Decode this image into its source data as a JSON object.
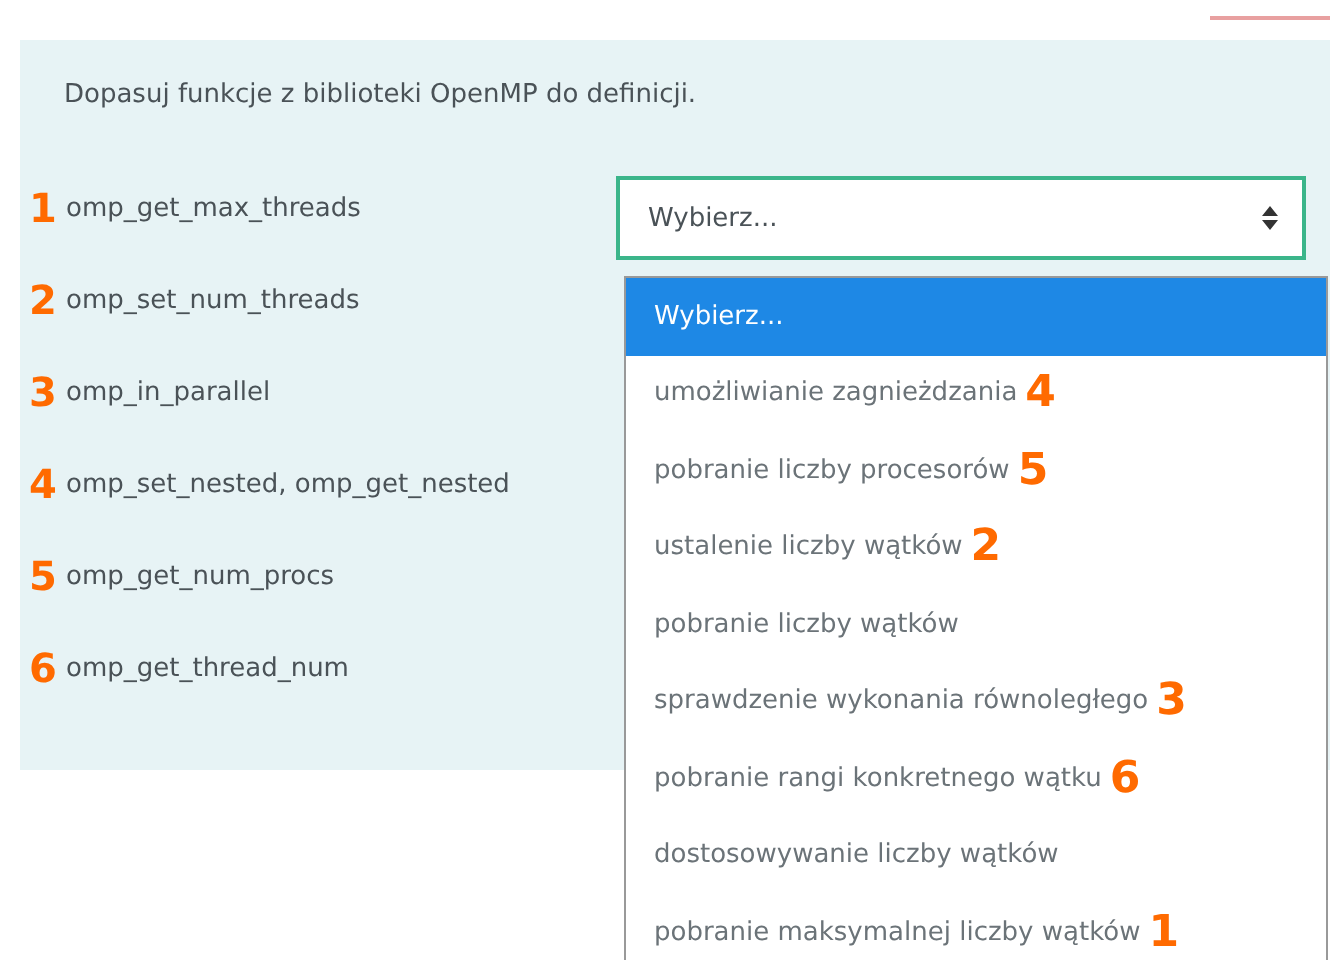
{
  "question": "Dopasuj funkcje z biblioteki OpenMP do definicji.",
  "rows": [
    {
      "mark": "1",
      "label": "omp_get_max_threads"
    },
    {
      "mark": "2",
      "label": "omp_set_num_threads"
    },
    {
      "mark": "3",
      "label": "omp_in_parallel"
    },
    {
      "mark": "4",
      "label": "omp_set_nested, omp_get_nested"
    },
    {
      "mark": "5",
      "label": "omp_get_num_procs"
    },
    {
      "mark": "6",
      "label": "omp_get_thread_num"
    }
  ],
  "select": {
    "value": "Wybierz..."
  },
  "options": [
    {
      "label": "Wybierz...",
      "selected": true
    },
    {
      "label": "umożliwianie zagnieżdzania",
      "selected": false,
      "mark": "4"
    },
    {
      "label": "pobranie liczby procesorów",
      "selected": false,
      "mark": "5"
    },
    {
      "label": "ustalenie liczby wątków",
      "selected": false,
      "mark": "2"
    },
    {
      "label": "pobranie liczby wątków",
      "selected": false
    },
    {
      "label": "sprawdzenie wykonania równoległego",
      "selected": false,
      "mark": "3"
    },
    {
      "label": "pobranie rangi konkretnego wątku",
      "selected": false,
      "mark": "6"
    },
    {
      "label": "dostosowywanie liczby wątków",
      "selected": false
    },
    {
      "label": "pobranie maksymalnej liczby wątków",
      "selected": false,
      "mark": "1"
    }
  ]
}
